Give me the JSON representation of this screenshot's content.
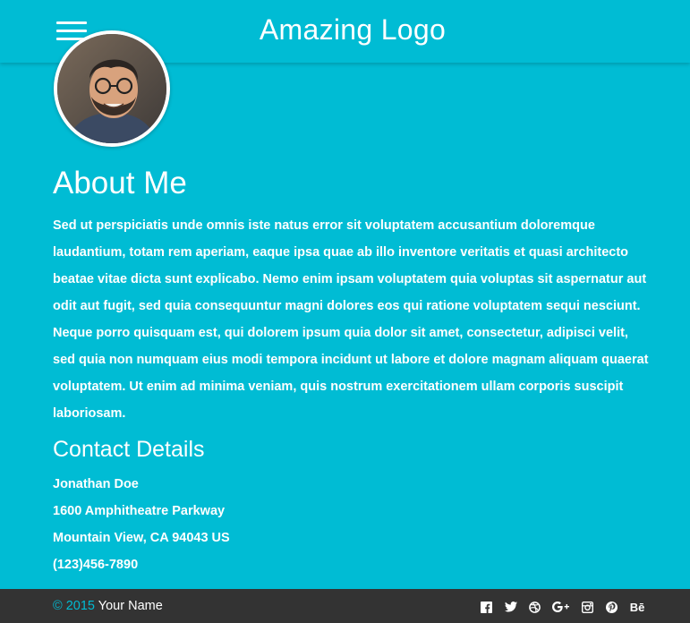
{
  "header": {
    "logo": "Amazing Logo"
  },
  "about": {
    "title": "About Me",
    "text": "Sed ut perspiciatis unde omnis iste natus error sit voluptatem accusantium doloremque laudantium, totam rem aperiam, eaque ipsa quae ab illo inventore veritatis et quasi architecto beatae vitae dicta sunt explicabo. Nemo enim ipsam voluptatem quia voluptas sit aspernatur aut odit aut fugit, sed quia consequuntur magni dolores eos qui ratione voluptatem sequi nesciunt. Neque porro quisquam est, qui dolorem ipsum quia dolor sit amet, consectetur, adipisci velit, sed quia non numquam eius modi tempora incidunt ut labore et dolore magnam aliquam quaerat voluptatem. Ut enim ad minima veniam, quis nostrum exercitationem ullam corporis suscipit laboriosam."
  },
  "contact": {
    "title": "Contact Details",
    "name": "Jonathan Doe",
    "street": "1600 Amphitheatre Parkway",
    "city": "Mountain View, CA 94043 US",
    "phone": "(123)456-7890"
  },
  "footer": {
    "copyright": "© 2015",
    "name": "Your Name",
    "social": [
      {
        "icon": "facebook-icon",
        "glyph": "f"
      },
      {
        "icon": "twitter-icon",
        "glyph": "t"
      },
      {
        "icon": "dribbble-icon",
        "glyph": "d"
      },
      {
        "icon": "google-plus-icon",
        "glyph": "G+"
      },
      {
        "icon": "instagram-icon",
        "glyph": "ig"
      },
      {
        "icon": "pinterest-icon",
        "glyph": "p"
      },
      {
        "icon": "behance-icon",
        "glyph": "Bē"
      }
    ]
  },
  "colors": {
    "primary": "#00bcd4",
    "footer": "#333333"
  }
}
